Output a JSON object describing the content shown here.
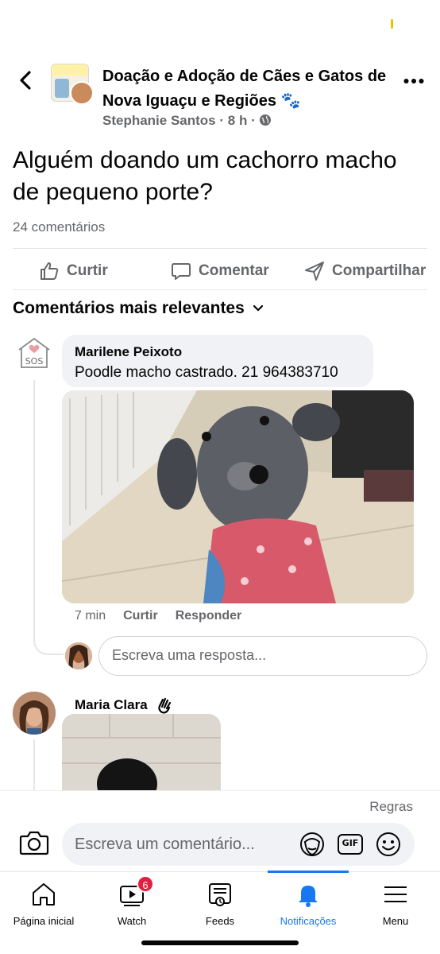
{
  "header": {
    "back_icon": "chevron-left-icon",
    "group_title": "Doação e Adoção de Cães e Gatos de Nova Iguaçu e Regiões 🐾",
    "author": "Stephanie Santos",
    "time": "8 h",
    "privacy_icon": "globe-icon",
    "more_icon": "more-horizontal-icon"
  },
  "post": {
    "text": "Alguém doando um cachorro macho de pequeno porte?",
    "comment_count": "24 comentários"
  },
  "actions": {
    "like": "Curtir",
    "comment": "Comentar",
    "share": "Compartilhar"
  },
  "comments_sort": "Comentários mais relevantes",
  "comments": [
    {
      "name": "Marilene Peixoto",
      "text": "Poodle macho castrado. 21 964383710",
      "time": "7 min",
      "like": "Curtir",
      "reply": "Responder"
    },
    {
      "name": "Maria Clara",
      "badge_icon": "wave-hand-icon"
    }
  ],
  "reply_placeholder": "Escreva uma resposta...",
  "composer": {
    "rules": "Regras",
    "placeholder": "Escreva um comentário...",
    "gif": "GIF"
  },
  "tabs": [
    {
      "label": "Página inicial",
      "icon": "home-icon"
    },
    {
      "label": "Watch",
      "icon": "watch-icon",
      "badge": "6"
    },
    {
      "label": "Feeds",
      "icon": "feeds-icon"
    },
    {
      "label": "Notificações",
      "icon": "bell-icon",
      "active": true
    },
    {
      "label": "Menu",
      "icon": "menu-icon"
    }
  ],
  "colors": {
    "accent": "#1877f2",
    "badge": "#e41e3f",
    "secondary_text": "#65676b"
  }
}
